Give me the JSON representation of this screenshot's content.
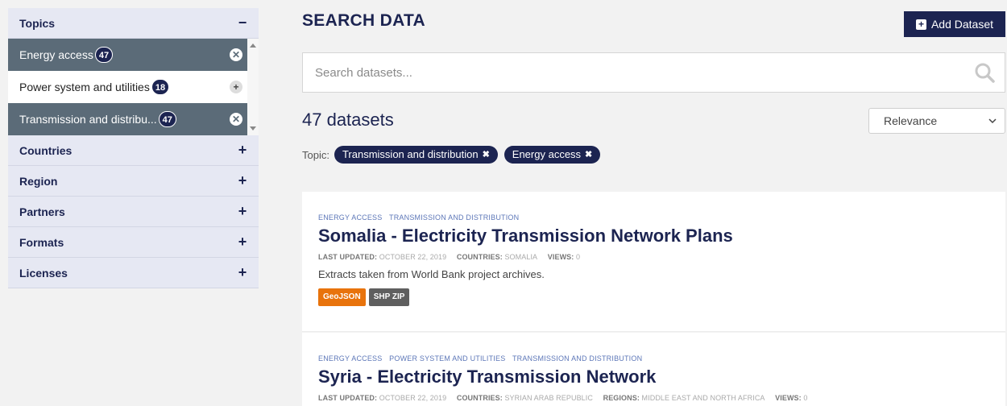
{
  "sidebar": {
    "topics": {
      "label": "Topics",
      "toggle": "−",
      "items": [
        {
          "label": "Energy access",
          "count": "47",
          "action": "✕",
          "active": true
        },
        {
          "label": "Power system and utilities",
          "count": "18",
          "action": "+",
          "active": false
        },
        {
          "label": "Transmission and distribu...",
          "count": "47",
          "action": "✕",
          "active": true
        }
      ]
    },
    "facets": [
      {
        "label": "Countries",
        "toggle": "+"
      },
      {
        "label": "Region",
        "toggle": "+"
      },
      {
        "label": "Partners",
        "toggle": "+"
      },
      {
        "label": "Formats",
        "toggle": "+"
      },
      {
        "label": "Licenses",
        "toggle": "+"
      }
    ]
  },
  "header": {
    "title": "SEARCH DATA",
    "add_button": "Add Dataset"
  },
  "search": {
    "placeholder": "Search datasets...",
    "icon": "search-icon"
  },
  "results": {
    "count_text": "47 datasets",
    "sort_value": "Relevance",
    "filter_label": "Topic:",
    "filters": [
      "Transmission and distribution",
      "Energy access"
    ]
  },
  "datasets": [
    {
      "tags": [
        "ENERGY ACCESS",
        "TRANSMISSION AND DISTRIBUTION"
      ],
      "title": "Somalia - Electricity Transmission Network Plans",
      "meta": {
        "updated_label": "LAST UPDATED:",
        "updated": "OCTOBER 22, 2019",
        "countries_label": "COUNTRIES:",
        "countries": "SOMALIA",
        "views_label": "VIEWS:",
        "views": "0"
      },
      "description": "Extracts taken from World Bank project archives.",
      "formats": [
        {
          "label": "GeoJSON",
          "color": "#e8730c"
        },
        {
          "label": "SHP ZIP",
          "color": "#5f5f5f"
        }
      ]
    },
    {
      "tags": [
        "ENERGY ACCESS",
        "POWER SYSTEM AND UTILITIES",
        "TRANSMISSION AND DISTRIBUTION"
      ],
      "title": "Syria - Electricity Transmission Network",
      "meta": {
        "updated_label": "LAST UPDATED:",
        "updated": "OCTOBER 22, 2019",
        "countries_label": "COUNTRIES:",
        "countries": "SYRIAN ARAB REPUBLIC",
        "regions_label": "REGIONS:",
        "regions": "MIDDLE EAST AND NORTH AFRICA",
        "views_label": "VIEWS:",
        "views": "0"
      }
    }
  ],
  "colors": {
    "brand": "#1c2451",
    "active_topic": "#5b6b78",
    "tag": "#5d77b8"
  }
}
